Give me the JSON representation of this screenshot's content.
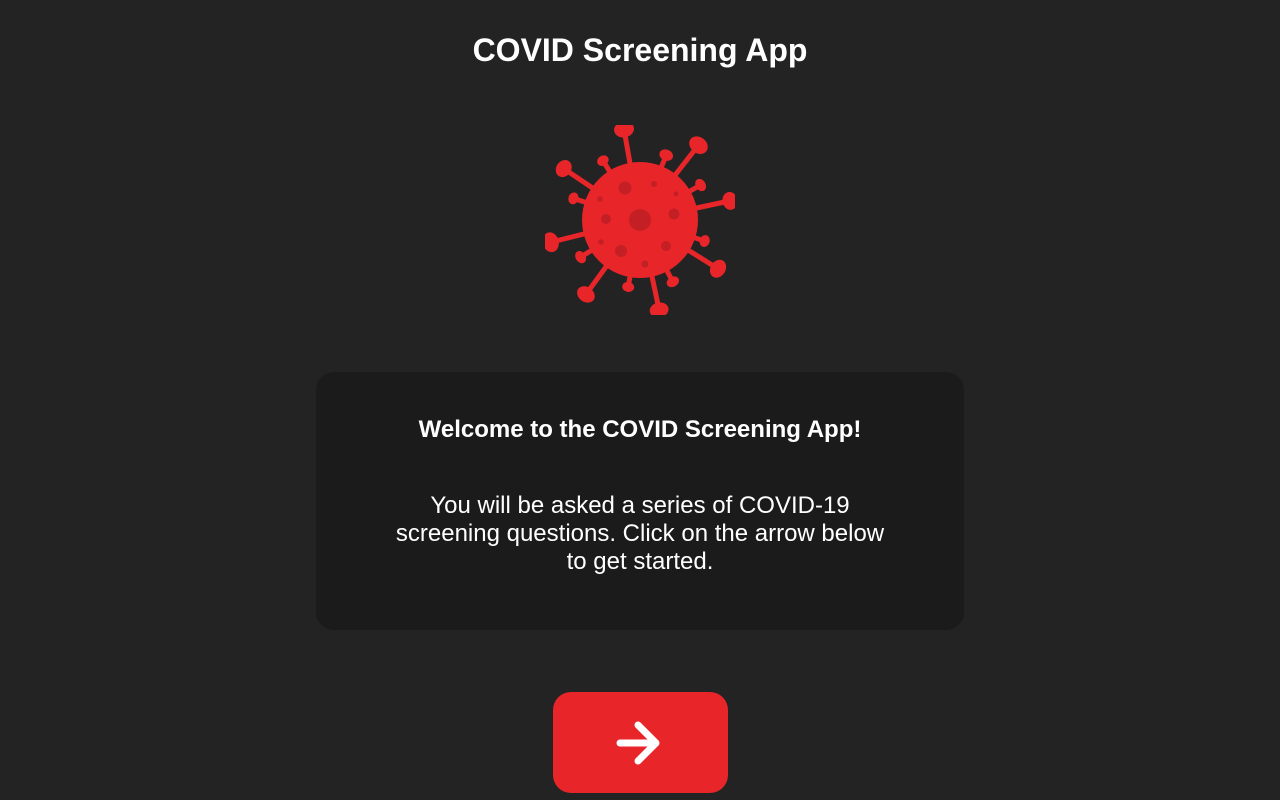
{
  "header": {
    "title": "COVID Screening App"
  },
  "hero": {
    "icon": "virus-icon",
    "color": "#e8262a"
  },
  "welcome_card": {
    "title": "Welcome to the COVID Screening App!",
    "body": "You will be asked a series of COVID-19 screening questions. Click on the arrow below to get started."
  },
  "start_button": {
    "icon": "arrow-right-icon",
    "color": "#e8262a"
  },
  "colors": {
    "background": "#232323",
    "card": "#1b1b1b",
    "accent": "#e8262a",
    "text": "#ffffff"
  }
}
